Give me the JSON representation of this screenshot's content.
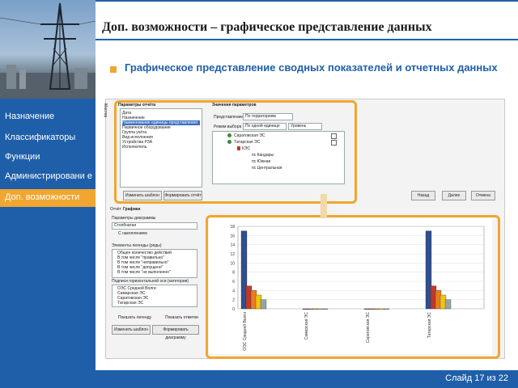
{
  "title": "Доп. возможности – графическое представление данных",
  "subtitle": "Графическое представление сводных показателей и отчетных данных",
  "sidebar": {
    "items": [
      {
        "label": "Назначение"
      },
      {
        "label": "Классификаторы"
      },
      {
        "label": "Функции"
      },
      {
        "label": "Администрировани е"
      }
    ],
    "active": "Доп. возможности"
  },
  "footer": {
    "slide": "Слайд 17 из 22"
  },
  "settings_window": {
    "side_label": "Мастер",
    "params_title": "Параметры отчёта",
    "params_list": [
      "Дата",
      "Назначение",
      "Наименование единицы представления",
      "Первичное оборудование",
      "Группа учёта",
      "Вид исполнения",
      "Устройства РЗА",
      "Исполнитель"
    ],
    "values_title": "Значения параметров",
    "representation_label": "Представление",
    "representation_value": "По территориям",
    "mode_label": "Режим выбора",
    "mode_value": "По одной единице",
    "level_value": "Уровень",
    "tree": [
      "Саратовская ЭС",
      "Татарская ЭС",
      "КЭС",
      "пс Кандары",
      "пс Южная",
      "пс Центральная"
    ],
    "buttons": {
      "change_template": "Изменить шаблон",
      "build_report": "Формировать отчёт",
      "back": "Назад",
      "next": "Далее",
      "cancel": "Отмена"
    }
  },
  "report_window": {
    "tabs": [
      "Отчёт",
      "Графики"
    ],
    "diagram_params": "Параметры диаграммы",
    "chart_type": "Столбчатая",
    "cumulative": "С накоплением",
    "axis_values": "Элементы легенды (ряды)",
    "legend_items": [
      "Общее количество действий",
      "В том числе \"правильно\"",
      "В том числе \"неправильно\"",
      "В том числе \"допущено\"",
      "В том числе \"не выполнено\""
    ],
    "horizontal_axis": "Подписи горизонтальной оси (категории)",
    "categories_list": [
      "ОЭС Средней Волги",
      "Самарская ЭС",
      "Саратовская ЭС",
      "Татарская ЭС"
    ],
    "show_legend": "Показать легенду",
    "show_labels": "Показать отметки",
    "buttons": {
      "change_template": "Изменить шаблон",
      "build_diagram": "Формировать диаграмму"
    }
  },
  "chart_data": {
    "type": "bar",
    "categories": [
      "ОЭС Средней Волги",
      "Самарская ЭС",
      "Саратовская ЭС",
      "Татарская ЭС"
    ],
    "series": [
      {
        "values": [
          17,
          0,
          0,
          17
        ]
      },
      {
        "values": [
          5,
          0,
          0,
          5
        ]
      },
      {
        "values": [
          4,
          0,
          0,
          4
        ]
      },
      {
        "values": [
          3,
          0,
          0,
          3
        ]
      },
      {
        "values": [
          2,
          0,
          0,
          2
        ]
      }
    ],
    "colors": [
      "#2f4f8f",
      "#c0392b",
      "#e67e22",
      "#f1c40f",
      "#95a5a6"
    ],
    "yticks": [
      "0",
      "2",
      "4",
      "6",
      "8",
      "10",
      "12",
      "14",
      "16",
      "18"
    ],
    "ylim": [
      0,
      18
    ]
  },
  "colors": {
    "accent": "#1f5fa9",
    "highlight": "#f0a630"
  }
}
